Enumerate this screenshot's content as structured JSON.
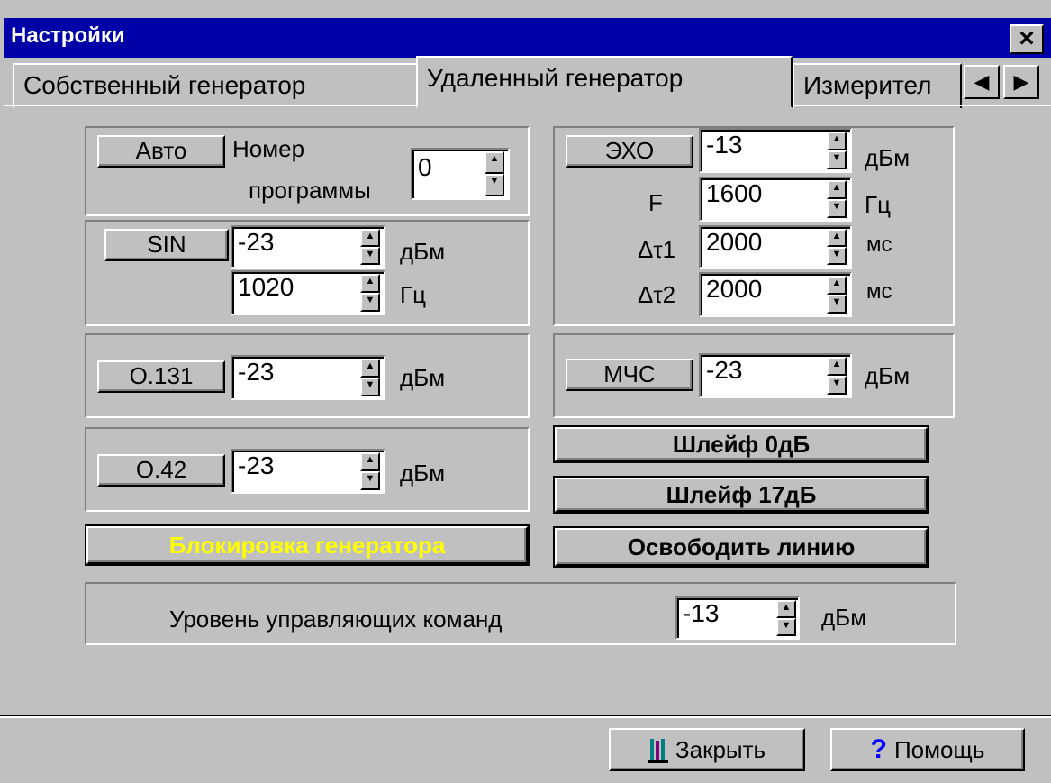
{
  "window": {
    "title": "Настройки",
    "close_label": "×"
  },
  "tabs": [
    {
      "label": "Собственный генератор"
    },
    {
      "label": "Удаленный генератор"
    },
    {
      "label": "Измерител"
    }
  ],
  "tab_scroll": {
    "left": "◀",
    "right": "▶"
  },
  "auto_group": {
    "button": "Авто",
    "label_line1": "Номер",
    "label_line2": "программы",
    "value": "0"
  },
  "sin_group": {
    "button": "SIN",
    "level": "-23",
    "level_unit": "дБм",
    "freq": "1020",
    "freq_unit": "Гц"
  },
  "o131_group": {
    "button": "О.131",
    "level": "-23",
    "unit": "дБм"
  },
  "o42_group": {
    "button": "О.42",
    "level": "-23",
    "unit": "дБм"
  },
  "echo_group": {
    "button": "ЭХО",
    "level": "-13",
    "level_unit": "дБм",
    "f_label": "F",
    "f_value": "1600",
    "f_unit": "Гц",
    "dt1_label": "Δτ1",
    "dt1_value": "2000",
    "dt1_unit": "мс",
    "dt2_label": "Δτ2",
    "dt2_value": "2000",
    "dt2_unit": "мс"
  },
  "mchs_group": {
    "button": "МЧС",
    "level": "-23",
    "unit": "дБм"
  },
  "actions": {
    "loop0": "Шлейф 0дБ",
    "loop17": "Шлейф 17дБ",
    "block_generator": "Блокировка генератора",
    "release_line": "Освободить линию"
  },
  "control_level": {
    "label": "Уровень управляющих команд",
    "value": "-13",
    "unit": "дБм"
  },
  "footer": {
    "close_label": "Закрыть",
    "help_label": "Помощь"
  },
  "colors": {
    "title_bar": "#0000a8",
    "block_text": "#ffff00",
    "face": "#c0c0c0"
  }
}
